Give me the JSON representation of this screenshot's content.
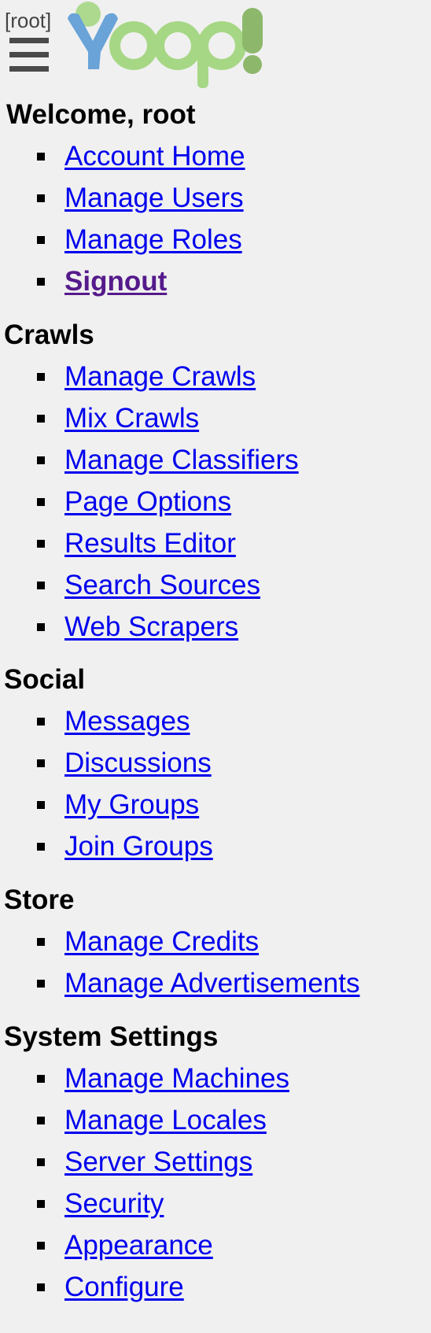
{
  "header": {
    "user_tag": "[root]",
    "logo_text": "Yioop!",
    "colors": {
      "y": "#5b9bd5",
      "ioo": "#a6d785",
      "p": "#a6d785",
      "bang": "#8db86b"
    }
  },
  "welcome": "Welcome, root",
  "account": {
    "items": [
      {
        "label": "Account Home"
      },
      {
        "label": "Manage Users"
      },
      {
        "label": "Manage Roles"
      },
      {
        "label": "Signout"
      }
    ]
  },
  "crawls": {
    "title": "Crawls",
    "items": [
      {
        "label": "Manage Crawls"
      },
      {
        "label": "Mix Crawls"
      },
      {
        "label": "Manage Classifiers"
      },
      {
        "label": "Page Options"
      },
      {
        "label": "Results Editor"
      },
      {
        "label": "Search Sources"
      },
      {
        "label": "Web Scrapers"
      }
    ]
  },
  "social": {
    "title": "Social",
    "items": [
      {
        "label": "Messages"
      },
      {
        "label": "Discussions"
      },
      {
        "label": "My Groups"
      },
      {
        "label": "Join Groups"
      }
    ]
  },
  "store": {
    "title": "Store",
    "items": [
      {
        "label": "Manage Credits"
      },
      {
        "label": "Manage Advertisements"
      }
    ]
  },
  "system": {
    "title": "System Settings",
    "items": [
      {
        "label": "Manage Machines"
      },
      {
        "label": "Manage Locales"
      },
      {
        "label": "Server Settings"
      },
      {
        "label": "Security"
      },
      {
        "label": "Appearance"
      },
      {
        "label": "Configure"
      }
    ]
  }
}
